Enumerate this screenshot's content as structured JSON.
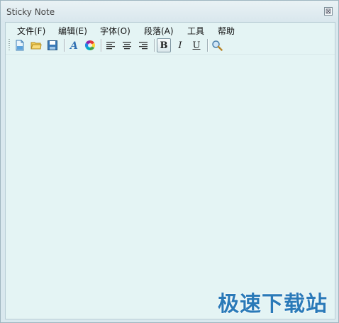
{
  "window": {
    "title": "Sticky Note",
    "close_glyph": "⊠"
  },
  "menu": [
    {
      "label": "文件(F)"
    },
    {
      "label": "编辑(E)"
    },
    {
      "label": "字体(O)"
    },
    {
      "label": "段落(A)"
    },
    {
      "label": "工具"
    },
    {
      "label": "帮助"
    }
  ],
  "toolbar": {
    "buttons": [
      {
        "icon": "new-document-icon"
      },
      {
        "icon": "open-folder-icon"
      },
      {
        "icon": "save-icon"
      },
      {
        "icon": "font-icon"
      },
      {
        "icon": "color-wheel-icon"
      },
      {
        "icon": "align-left-icon"
      },
      {
        "icon": "align-center-icon"
      },
      {
        "icon": "align-right-icon"
      },
      {
        "icon": "bold-icon",
        "glyph": "B",
        "active": true
      },
      {
        "icon": "italic-icon",
        "glyph": "I"
      },
      {
        "icon": "underline-icon",
        "glyph": "U"
      },
      {
        "icon": "search-icon"
      }
    ]
  },
  "editor": {
    "content": ""
  },
  "watermark": "极速下载站",
  "colors": {
    "background": "#e4f4f4",
    "watermark": "#2a7ab8"
  }
}
